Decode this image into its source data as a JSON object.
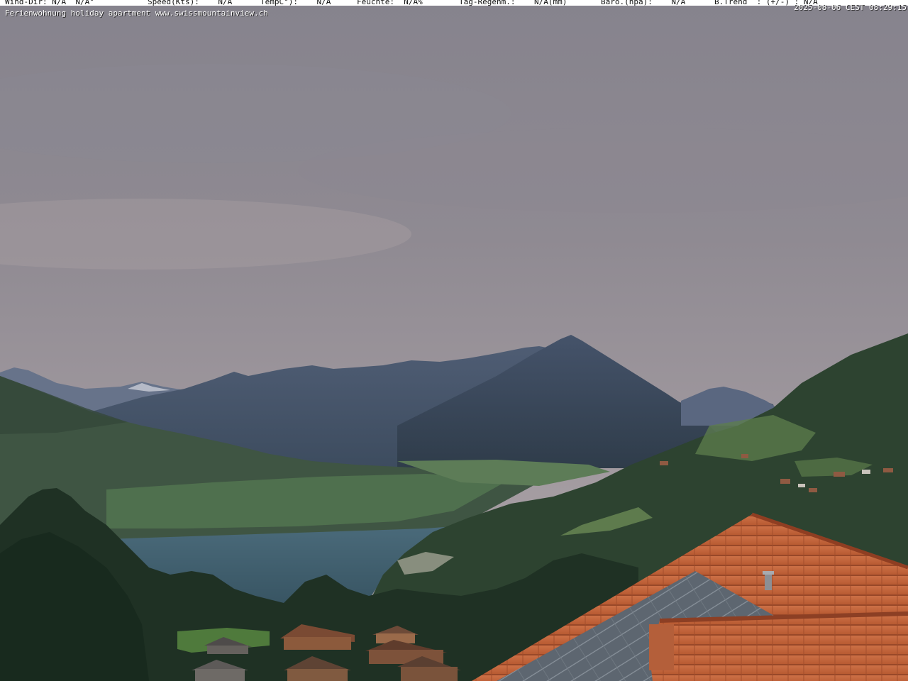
{
  "weather_bar": {
    "wind_dir_label": "Wind-Dir: N/A  N/A°",
    "speed_label": "Speed(Kts):    N/A",
    "temp_label": "TempC°):    N/A",
    "humidity_label": "Feuchte:  N/A%",
    "rain_label": "Tag-Regenm.:    N/A(mm)",
    "baro_label": "Baro.(hpa):    N/A",
    "trend_label": "B.Trend  : (+/-) : N/A"
  },
  "caption": "Ferienwohnung holiday apartment www.swissmountainview.ch",
  "timestamp": "2025-08-06 CEST 08:29:15",
  "colors": {
    "sky_top": "#86838d",
    "sky_bottom": "#a79ea0",
    "lake": "#3e5e6f",
    "roof_tile": "#c2653c",
    "solar_panel": "#5d6670"
  }
}
